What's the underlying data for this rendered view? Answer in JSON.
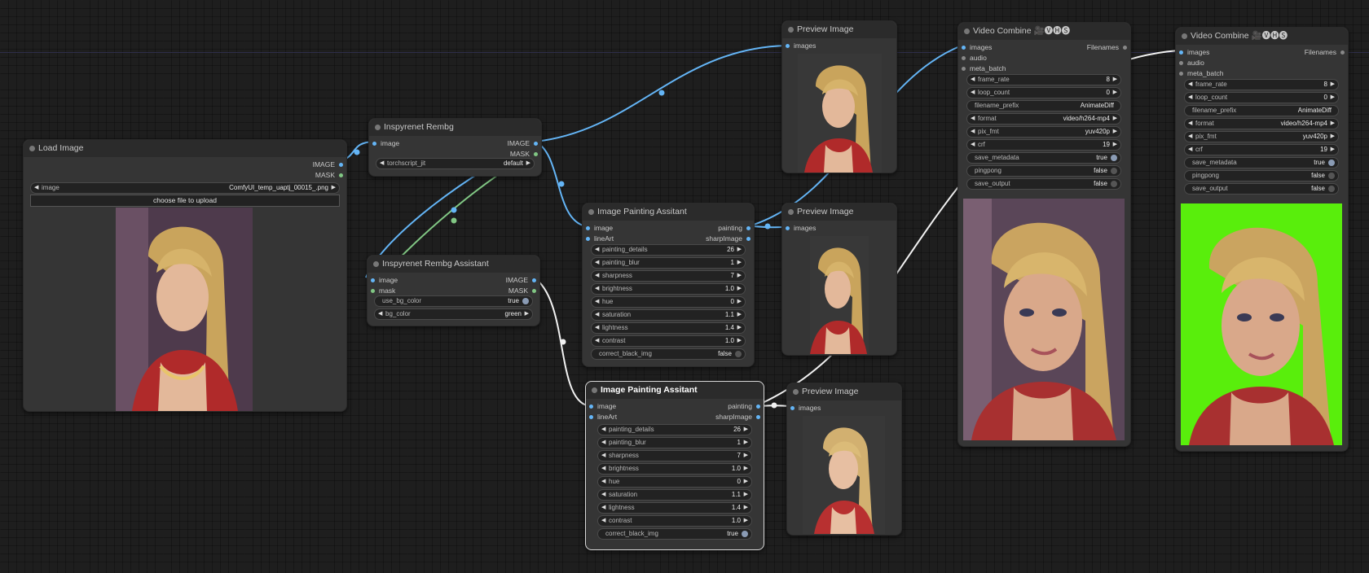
{
  "colors": {
    "canvas": "#1e1e1e",
    "node": "#353535",
    "image_link": "#64b5f6",
    "mask_link": "#81c784"
  },
  "load_image": {
    "title": "Load Image",
    "outputs": [
      "IMAGE",
      "MASK"
    ],
    "image_widget": {
      "label": "image",
      "value": "ComfyUI_temp_uaptj_00015_.png"
    },
    "upload_label": "choose file to upload"
  },
  "rembg": {
    "title": "Inspyrenet Rembg",
    "inputs": [
      "image"
    ],
    "outputs": [
      "IMAGE",
      "MASK"
    ],
    "widget": {
      "label": "torchscript_jit",
      "value": "default"
    }
  },
  "rembg_assistant": {
    "title": "Inspyrenet Rembg Assistant",
    "inputs": [
      "image",
      "mask"
    ],
    "outputs": [
      "IMAGE",
      "MASK"
    ],
    "use_bg_color": {
      "label": "use_bg_color",
      "value": "true"
    },
    "bg_color": {
      "label": "bg_color",
      "value": "green"
    }
  },
  "painting_1": {
    "title": "Image Painting Assitant",
    "inputs": [
      "image",
      "lineArt"
    ],
    "outputs": [
      "painting",
      "sharpImage"
    ],
    "widgets": [
      {
        "label": "painting_details",
        "value": "26"
      },
      {
        "label": "painting_blur",
        "value": "1"
      },
      {
        "label": "sharpness",
        "value": "7"
      },
      {
        "label": "brightness",
        "value": "1.0"
      },
      {
        "label": "hue",
        "value": "0"
      },
      {
        "label": "saturation",
        "value": "1.1"
      },
      {
        "label": "lightness",
        "value": "1.4"
      },
      {
        "label": "contrast",
        "value": "1.0"
      }
    ],
    "toggle": {
      "label": "correct_black_img",
      "value": "false"
    }
  },
  "painting_2": {
    "title": "Image Painting Assitant",
    "inputs": [
      "image",
      "lineArt"
    ],
    "outputs": [
      "painting",
      "sharpImage"
    ],
    "widgets": [
      {
        "label": "painting_details",
        "value": "26"
      },
      {
        "label": "painting_blur",
        "value": "1"
      },
      {
        "label": "sharpness",
        "value": "7"
      },
      {
        "label": "brightness",
        "value": "1.0"
      },
      {
        "label": "hue",
        "value": "0"
      },
      {
        "label": "saturation",
        "value": "1.1"
      },
      {
        "label": "lightness",
        "value": "1.4"
      },
      {
        "label": "contrast",
        "value": "1.0"
      }
    ],
    "toggle": {
      "label": "correct_black_img",
      "value": "true"
    }
  },
  "preview_1": {
    "title": "Preview Image",
    "inputs": [
      "images"
    ]
  },
  "preview_2": {
    "title": "Preview Image",
    "inputs": [
      "images"
    ]
  },
  "preview_3": {
    "title": "Preview Image",
    "inputs": [
      "images"
    ]
  },
  "video_1": {
    "title": "Video Combine 🎥🅥🅗🅢",
    "inputs": [
      "images",
      "audio",
      "meta_batch"
    ],
    "outputs": [
      "Filenames"
    ],
    "frame_rate": {
      "label": "frame_rate",
      "value": "8"
    },
    "loop_count": {
      "label": "loop_count",
      "value": "0"
    },
    "filename_prefix": {
      "label": "filename_prefix",
      "value": "AnimateDiff"
    },
    "format": {
      "label": "format",
      "value": "video/h264-mp4"
    },
    "pix_fmt": {
      "label": "pix_fmt",
      "value": "yuv420p"
    },
    "crf": {
      "label": "crf",
      "value": "19"
    },
    "save_metadata": {
      "label": "save_metadata",
      "value": "true"
    },
    "pingpong": {
      "label": "pingpong",
      "value": "false"
    },
    "save_output": {
      "label": "save_output",
      "value": "false"
    }
  },
  "video_2": {
    "title": "Video Combine 🎥🅥🅗🅢",
    "inputs": [
      "images",
      "audio",
      "meta_batch"
    ],
    "outputs": [
      "Filenames"
    ],
    "frame_rate": {
      "label": "frame_rate",
      "value": "8"
    },
    "loop_count": {
      "label": "loop_count",
      "value": "0"
    },
    "filename_prefix": {
      "label": "filename_prefix",
      "value": "AnimateDiff"
    },
    "format": {
      "label": "format",
      "value": "video/h264-mp4"
    },
    "pix_fmt": {
      "label": "pix_fmt",
      "value": "yuv420p"
    },
    "crf": {
      "label": "crf",
      "value": "19"
    },
    "save_metadata": {
      "label": "save_metadata",
      "value": "true"
    },
    "pingpong": {
      "label": "pingpong",
      "value": "false"
    },
    "save_output": {
      "label": "save_output",
      "value": "false"
    }
  }
}
